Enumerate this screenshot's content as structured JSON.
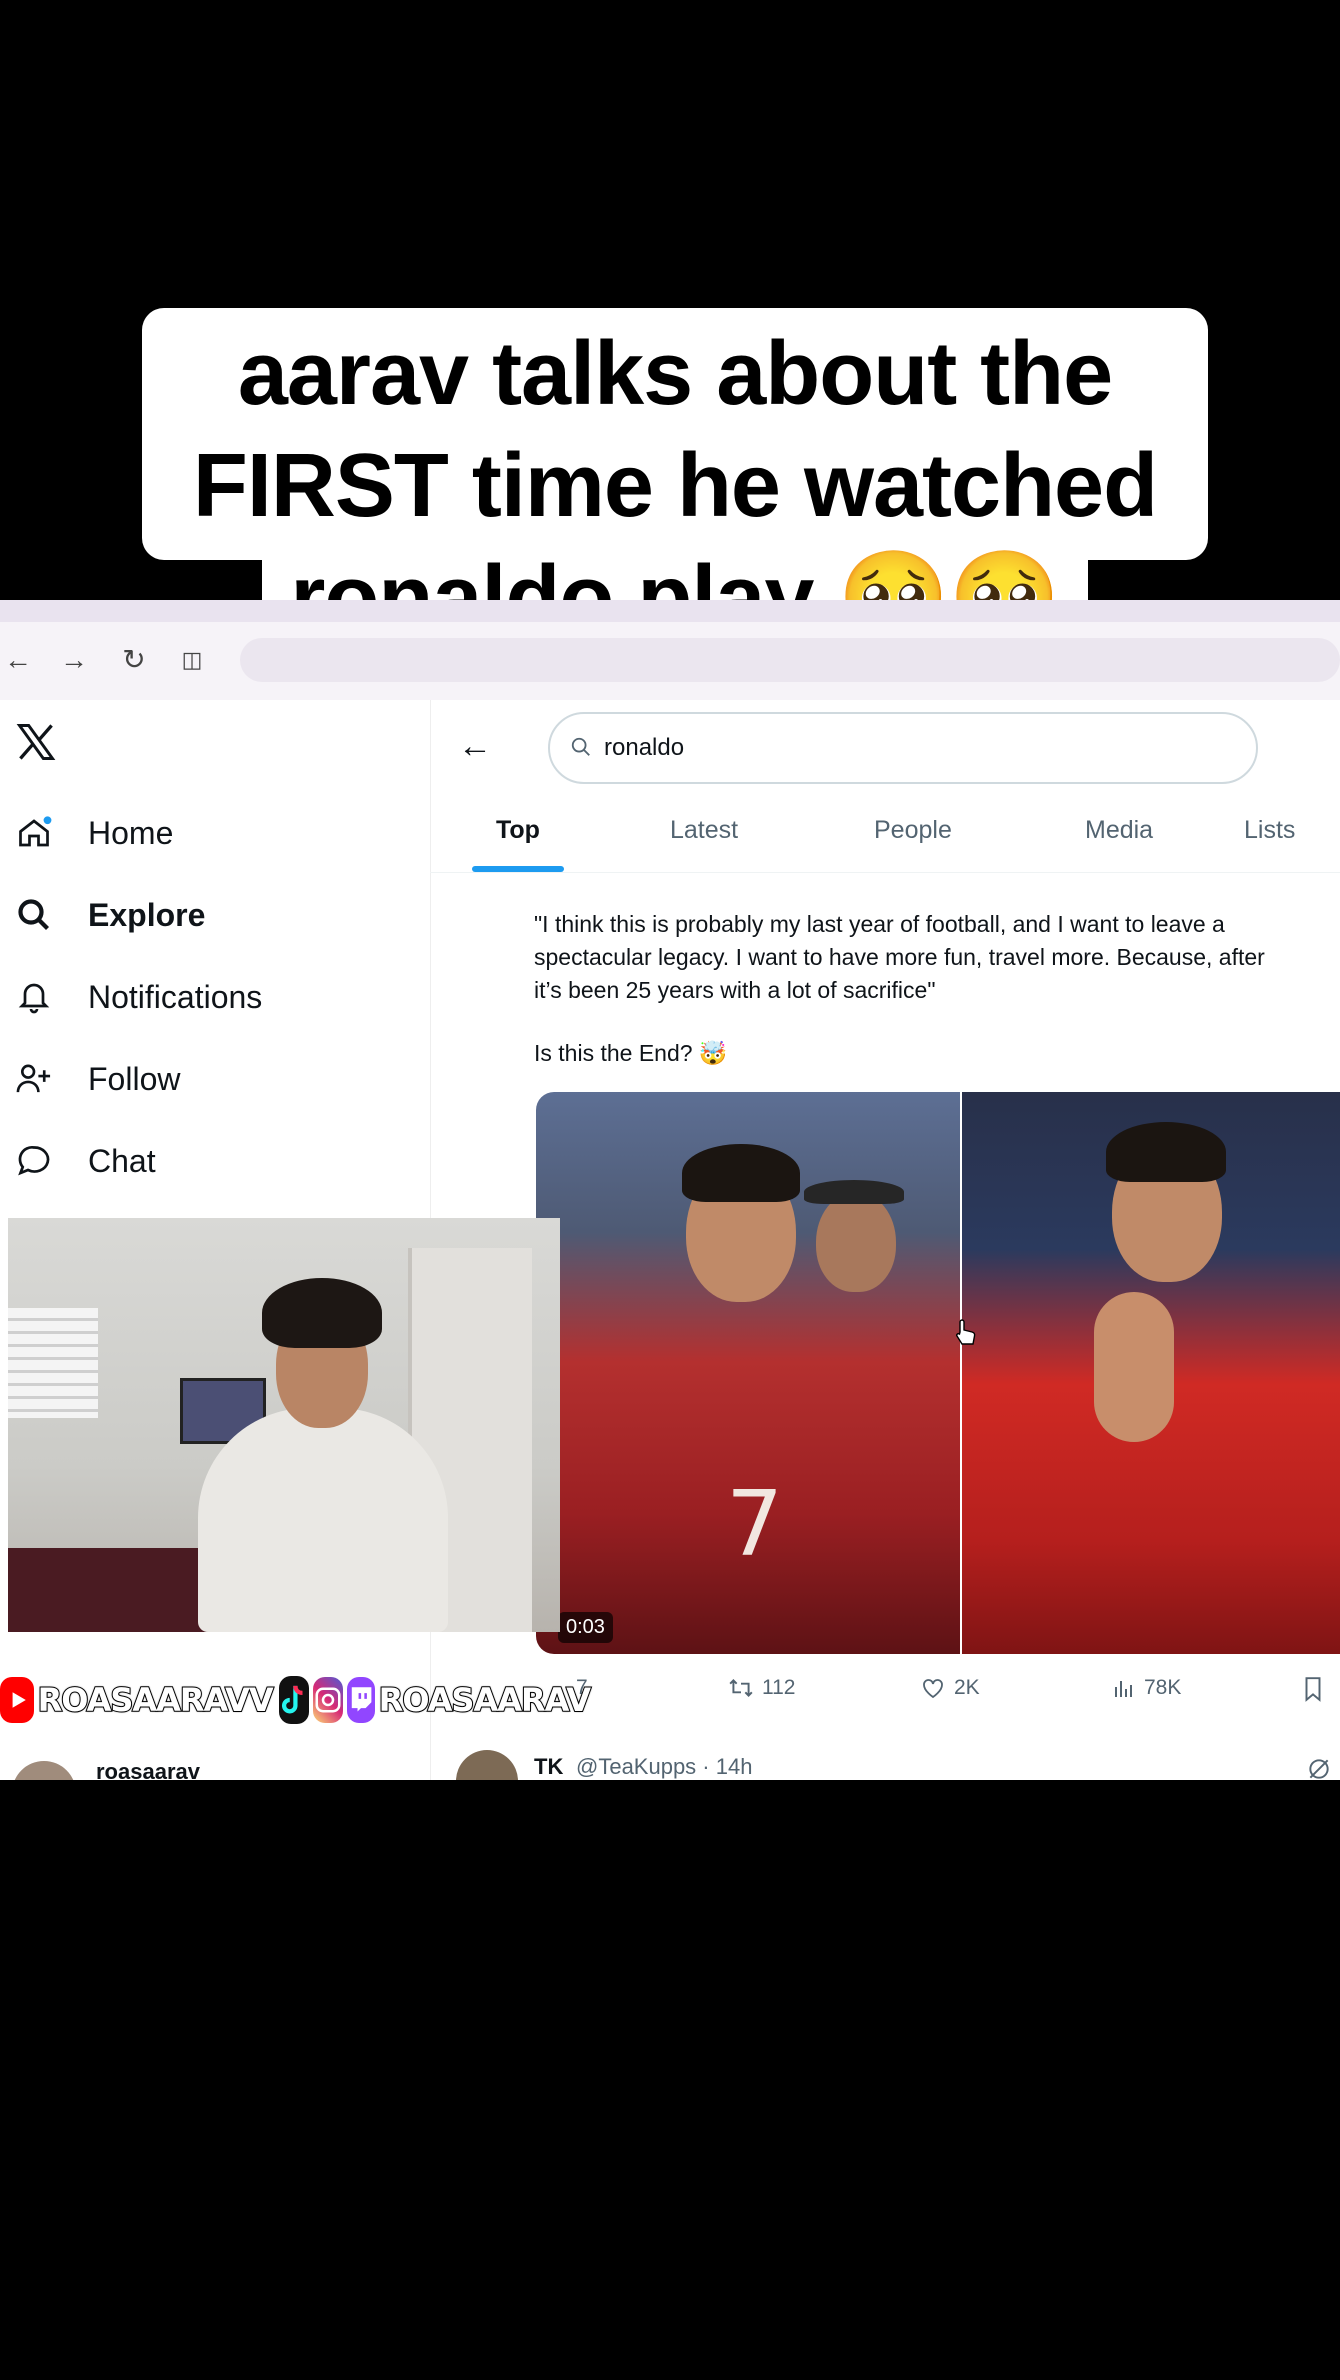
{
  "caption": {
    "line1": "aarav talks about the",
    "line2": "FIRST time he watched",
    "line3": "ronaldo play 🥹🥹"
  },
  "browser": {
    "back_icon": "arrow-left-icon",
    "forward_icon": "arrow-right-icon",
    "reload_icon": "reload-icon",
    "split_icon": "split-view-icon"
  },
  "sidebar": {
    "items": [
      {
        "label": "Home",
        "icon": "home-icon"
      },
      {
        "label": "Explore",
        "icon": "search-icon"
      },
      {
        "label": "Notifications",
        "icon": "bell-icon"
      },
      {
        "label": "Follow",
        "icon": "add-person-icon"
      },
      {
        "label": "Chat",
        "icon": "chat-icon"
      }
    ],
    "account_name": "roasaarav"
  },
  "search": {
    "query": "ronaldo"
  },
  "tabs": [
    {
      "label": "Top",
      "active": true
    },
    {
      "label": "Latest",
      "active": false
    },
    {
      "label": "People",
      "active": false
    },
    {
      "label": "Media",
      "active": false
    },
    {
      "label": "Lists",
      "active": false
    }
  ],
  "tweet": {
    "text": "\"I think this is probably my last year of football, and I want to leave a\nspectacular legacy.  I want to have more fun, travel more. Because, after\nit’s been 25 years with a lot of sacrifice\"",
    "question": "Is this the End? 🤯",
    "video_time": "0:03",
    "shirt_number": "7",
    "replies": "7",
    "retweets": "112",
    "likes": "2K",
    "views": "78K"
  },
  "tweet2": {
    "name": "TK",
    "handle_time": "@TeaKupps · 14h"
  },
  "social": {
    "youtube_handle": "ROASAARAVV",
    "twitch_handle": "ROASAARAV"
  },
  "colors": {
    "accent": "#1d9bf0",
    "notification_dot": "#1d9bf0",
    "youtube": "#ff0000",
    "twitch": "#9146ff"
  }
}
